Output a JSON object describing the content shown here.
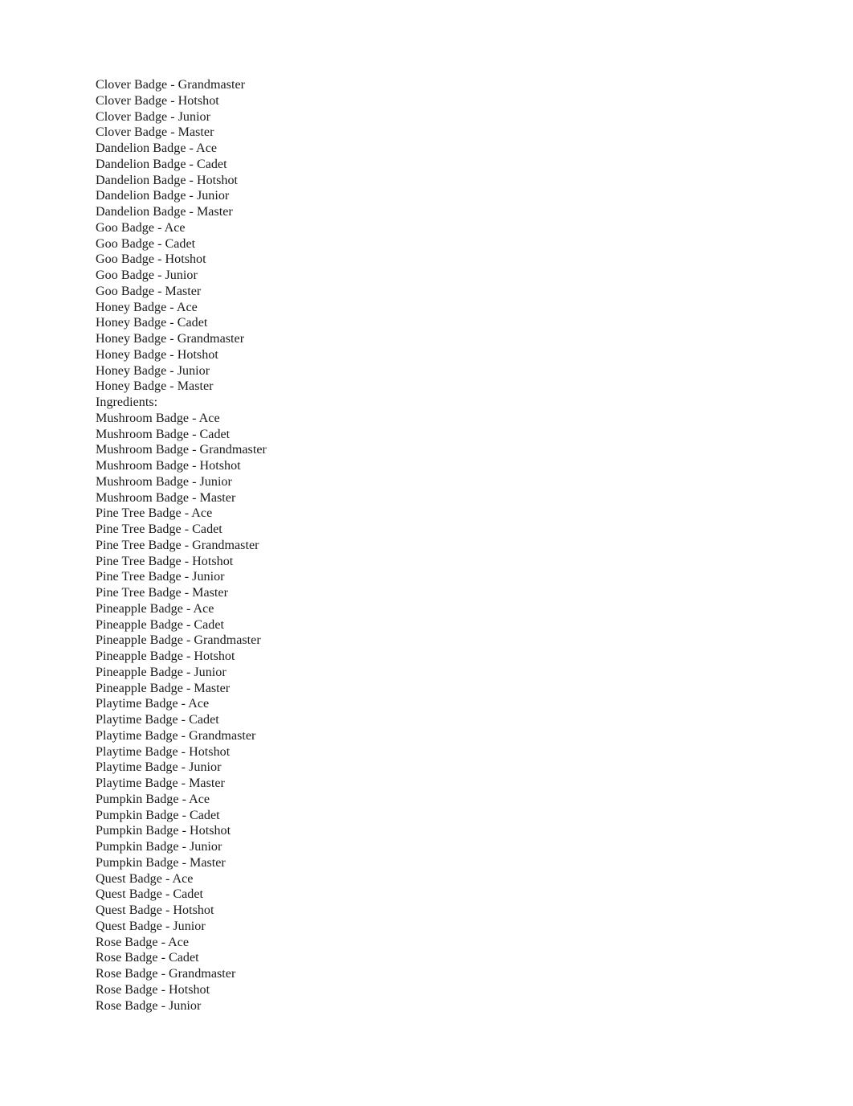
{
  "document": {
    "background_color": "#ffffff",
    "text_color": "#1a1a1a",
    "lines": [
      {
        "text": "Clover Badge - Grandmaster"
      },
      {
        "text": "Clover Badge - Hotshot"
      },
      {
        "text": "Clover Badge - Junior"
      },
      {
        "text": "Clover Badge - Master"
      },
      {
        "text": "Dandelion Badge - Ace"
      },
      {
        "text": "Dandelion Badge - Cadet"
      },
      {
        "text": "Dandelion Badge - Hotshot"
      },
      {
        "text": "Dandelion Badge - Junior"
      },
      {
        "text": "Dandelion Badge - Master"
      },
      {
        "text": "Goo Badge - Ace"
      },
      {
        "text": "Goo Badge - Cadet"
      },
      {
        "text": "Goo Badge - Hotshot"
      },
      {
        "text": "Goo Badge - Junior"
      },
      {
        "text": "Goo Badge - Master"
      },
      {
        "text": "Honey Badge - Ace"
      },
      {
        "text": "Honey Badge - Cadet"
      },
      {
        "text": "Honey Badge - Grandmaster"
      },
      {
        "text": "Honey Badge - Hotshot"
      },
      {
        "text": "Honey Badge - Junior"
      },
      {
        "text": "Honey Badge - Master"
      },
      {
        "text": "Ingredients:"
      },
      {
        "text": "Mushroom Badge - Ace"
      },
      {
        "text": "Mushroom Badge - Cadet"
      },
      {
        "text": "Mushroom Badge - Grandmaster"
      },
      {
        "text": "Mushroom Badge - Hotshot"
      },
      {
        "text": "Mushroom Badge - Junior"
      },
      {
        "text": "Mushroom Badge - Master"
      },
      {
        "text": "Pine Tree Badge - Ace"
      },
      {
        "text": "Pine Tree Badge - Cadet"
      },
      {
        "text": "Pine Tree Badge - Grandmaster"
      },
      {
        "text": "Pine Tree Badge - Hotshot"
      },
      {
        "text": "Pine Tree Badge - Junior"
      },
      {
        "text": "Pine Tree Badge - Master"
      },
      {
        "text": "Pineapple Badge - Ace"
      },
      {
        "text": "Pineapple Badge - Cadet"
      },
      {
        "text": "Pineapple Badge - Grandmaster"
      },
      {
        "text": "Pineapple Badge - Hotshot"
      },
      {
        "text": "Pineapple Badge - Junior"
      },
      {
        "text": "Pineapple Badge - Master"
      },
      {
        "text": "Playtime Badge - Ace"
      },
      {
        "text": "Playtime Badge - Cadet"
      },
      {
        "text": "Playtime Badge - Grandmaster"
      },
      {
        "text": "Playtime Badge - Hotshot"
      },
      {
        "text": "Playtime Badge - Junior"
      },
      {
        "text": "Playtime Badge - Master"
      },
      {
        "text": "Pumpkin Badge - Ace"
      },
      {
        "text": "Pumpkin Badge - Cadet"
      },
      {
        "text": "Pumpkin Badge - Hotshot"
      },
      {
        "text": "Pumpkin Badge - Junior"
      },
      {
        "text": "Pumpkin Badge - Master"
      },
      {
        "text": "Quest Badge - Ace"
      },
      {
        "text": "Quest Badge - Cadet"
      },
      {
        "text": "Quest Badge - Hotshot"
      },
      {
        "text": "Quest Badge - Junior"
      },
      {
        "text": "Rose Badge - Ace"
      },
      {
        "text": "Rose Badge - Cadet"
      },
      {
        "text": "Rose Badge - Grandmaster"
      },
      {
        "text": "Rose Badge - Hotshot"
      },
      {
        "text": "Rose Badge - Junior"
      }
    ]
  }
}
